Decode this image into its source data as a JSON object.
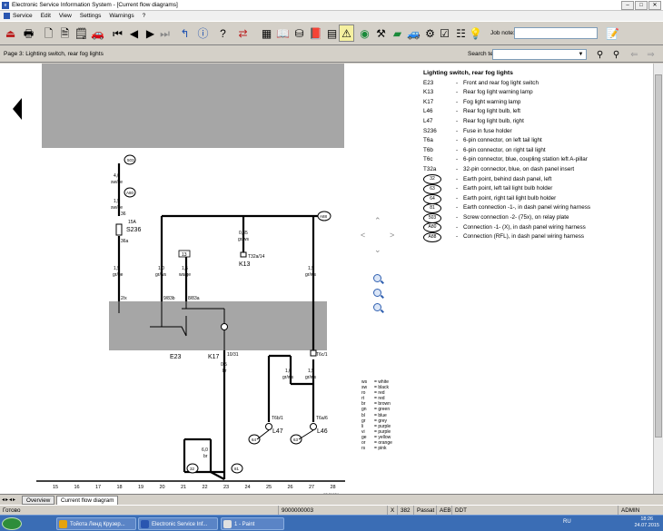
{
  "window": {
    "title": "Electronic Service Information System - [Current flow diagrams]"
  },
  "menu": [
    "Service",
    "Edit",
    "View",
    "Settings",
    "Warnings",
    "?"
  ],
  "toolbar": {
    "job_note_label": "Job note:",
    "job_note_value": ""
  },
  "navbar": {
    "page_label": "Page 3: Lighting switch, rear fog lights",
    "search_label": "Search term:",
    "search_value": ""
  },
  "legend": {
    "title": "Lighting switch, rear fog lights",
    "items": [
      {
        "code": "E23",
        "desc": "Front and rear fog light switch"
      },
      {
        "code": "K13",
        "desc": "Rear fog light warning lamp"
      },
      {
        "code": "K17",
        "desc": "Fog light warning lamp"
      },
      {
        "code": "L46",
        "desc": "Rear fog light bulb, left"
      },
      {
        "code": "L47",
        "desc": "Rear fog light bulb, right"
      },
      {
        "code": "S236",
        "desc": "Fuse in fuse holder"
      },
      {
        "code": "T6a",
        "desc": "6-pin connector, on left tail light"
      },
      {
        "code": "T6b",
        "desc": "6-pin connector, on right tail light"
      },
      {
        "code": "T6c",
        "desc": "6-pin connector, blue, coupling station left A-pillar"
      },
      {
        "code": "T32a",
        "desc": "32-pin connector, blue, on dash panel insert"
      }
    ],
    "earth_items": [
      {
        "code": "32",
        "desc": "Earth point, behind dash panel, left"
      },
      {
        "code": "63",
        "desc": "Earth point, left tail light bulb holder"
      },
      {
        "code": "64",
        "desc": "Earth point, right tail light bulb holder"
      },
      {
        "code": "81",
        "desc": "Earth connection -1-, in dash panel wiring harness"
      },
      {
        "code": "503",
        "desc": "Screw connection -2- (75x), on relay plate"
      },
      {
        "code": "A80",
        "desc": "Connection -1- (X), in dash panel wiring harness"
      },
      {
        "code": "A88",
        "desc": "Connection (RFL), in dash panel wiring harness"
      }
    ]
  },
  "color_key": [
    {
      "abbr": "ws",
      "name": "white"
    },
    {
      "abbr": "sw",
      "name": "black"
    },
    {
      "abbr": "ro",
      "name": "red"
    },
    {
      "abbr": "rt",
      "name": "red"
    },
    {
      "abbr": "br",
      "name": "brown"
    },
    {
      "abbr": "gn",
      "name": "green"
    },
    {
      "abbr": "bl",
      "name": "blue"
    },
    {
      "abbr": "gr",
      "name": "grey"
    },
    {
      "abbr": "li",
      "name": "purple"
    },
    {
      "abbr": "vi",
      "name": "purple"
    },
    {
      "abbr": "ge",
      "name": "yellow"
    },
    {
      "abbr": "or",
      "name": "orange"
    },
    {
      "abbr": "rs",
      "name": "pink"
    }
  ],
  "diagram": {
    "track_numbers": [
      "15",
      "16",
      "17",
      "18",
      "19",
      "20",
      "21",
      "22",
      "23",
      "24",
      "25",
      "26",
      "27",
      "28"
    ],
    "page_ref": "97-31634",
    "labels": {
      "c503": "503",
      "wire1": "4,0",
      "wire1c": "sw/ge",
      "a80": "A80",
      "wire2": "1,5",
      "wire2c": "sw/ge",
      "fuse_amp": "15A",
      "fuse": "S236",
      "fuse_pin1": "36",
      "fuse_pin2": "36a",
      "a88": "A88",
      "k13wire": "0,35",
      "k13wirec": "gr/ws",
      "t32a": "T32a/14",
      "k13": "K13",
      "box13": "13",
      "w_a": "1,5",
      "w_ac": "gr/ge",
      "w_b": "1,0",
      "w_bc": "gr/ws",
      "w_c": "1,5",
      "w_cc": "ws/ge",
      "w_d": "1,5",
      "w_dc": "gr/ws",
      "pin_a": "2/x",
      "pin_b": "9/83b",
      "pin_c": "8/83a",
      "e23": "E23",
      "k17": "K17",
      "t32_31": "10/31",
      "w_e": "0,5",
      "w_ec": "br",
      "t6c1": "T6c/1",
      "w_f": "1,0",
      "w_fc": "gr/ws",
      "w_g": "1,5",
      "w_gc": "gr/ws",
      "t6b1": "T6b/1",
      "t6a6": "T6a/6",
      "l47": "L47",
      "l46": "L46",
      "e64": "64",
      "e63": "63",
      "w_h": "6,0",
      "w_hc": "br",
      "e32": "32",
      "e81": "81"
    }
  },
  "tabs": [
    "Overview",
    "Current flow diagram"
  ],
  "status": {
    "ready": "Готово",
    "code": "9000000003",
    "x": "X",
    "num": "382",
    "model": "Passat",
    "c1": "AEB",
    "c2": "DDT",
    "user": "ADMIN"
  },
  "taskbar": {
    "items": [
      "Тойота Ленд Крузер...",
      "Electronic Service Inf...",
      "1 - Paint"
    ],
    "lang": "RU",
    "time": "18:26",
    "date": "24.07.2015"
  }
}
